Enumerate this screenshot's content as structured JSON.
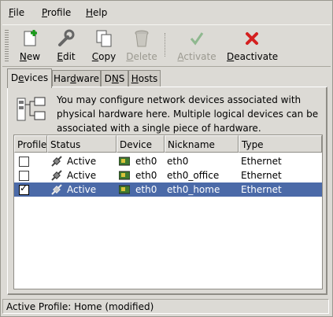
{
  "menubar": {
    "file": "File",
    "profile": "Profile",
    "help": "Help"
  },
  "toolbar": {
    "new": "New",
    "edit": "Edit",
    "copy": "Copy",
    "delete": "Delete",
    "activate": "Activate",
    "deactivate": "Deactivate"
  },
  "tabs": [
    "Devices",
    "Hardware",
    "DNS",
    "Hosts"
  ],
  "info_text": "You may configure network devices associated with physical hardware here.  Multiple logical devices can be associated with a single piece of hardware.",
  "table": {
    "columns": [
      "Profile",
      "Status",
      "Device",
      "Nickname",
      "Type"
    ],
    "rows": [
      {
        "profile_checked": false,
        "status": "Active",
        "device": "eth0",
        "nickname": "eth0",
        "type": "Ethernet",
        "selected": false
      },
      {
        "profile_checked": false,
        "status": "Active",
        "device": "eth0",
        "nickname": "eth0_office",
        "type": "Ethernet",
        "selected": false
      },
      {
        "profile_checked": true,
        "status": "Active",
        "device": "eth0",
        "nickname": "eth0_home",
        "type": "Ethernet",
        "selected": true
      }
    ]
  },
  "statusbar": "Active Profile: Home (modified)",
  "colors": {
    "selection": "#4b6aa8",
    "window_bg": "#dcdad5"
  }
}
